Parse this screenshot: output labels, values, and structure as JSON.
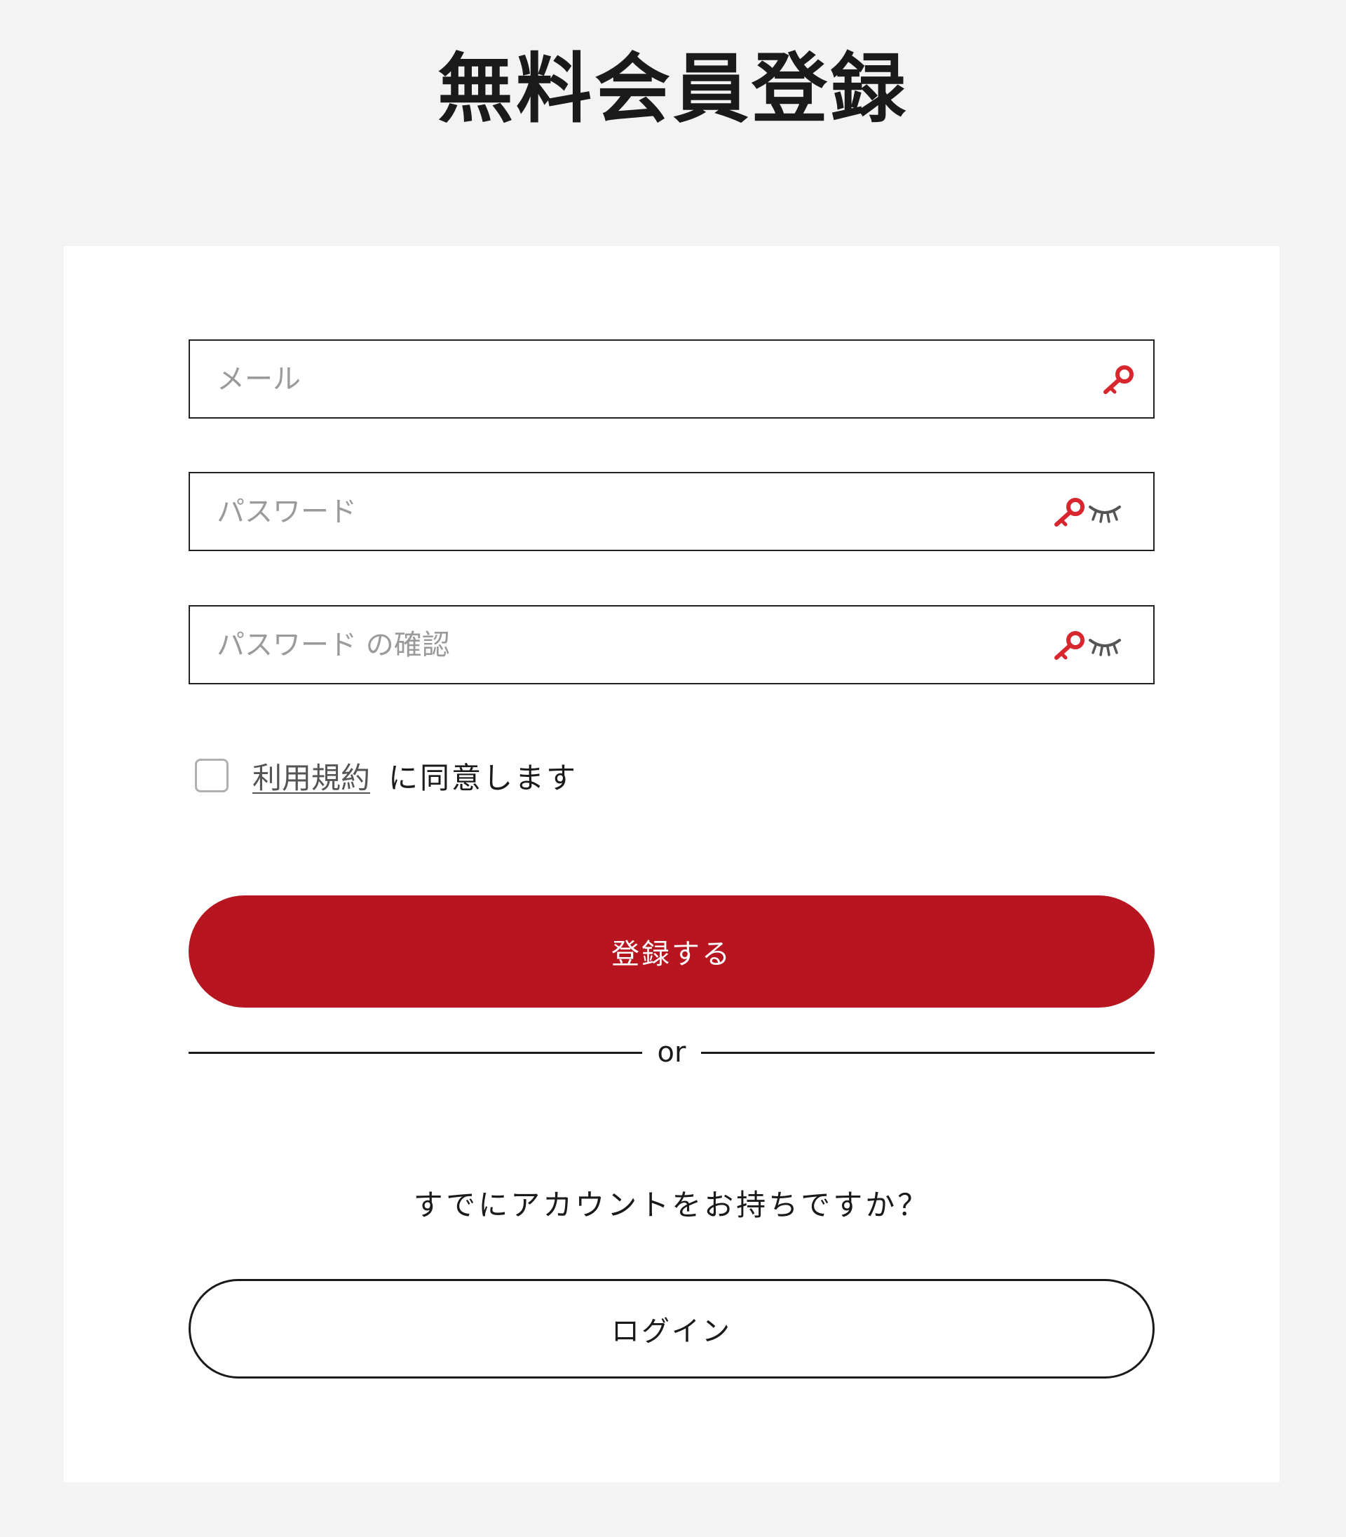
{
  "page": {
    "title": "無料会員登録"
  },
  "form": {
    "email_placeholder": "メール",
    "password_placeholder": "パスワード",
    "confirm_placeholder": "パスワード の確認",
    "terms_link": "利用規約",
    "terms_suffix": "に同意します",
    "terms_checked": false,
    "register_label": "登録する"
  },
  "divider": {
    "label": "or"
  },
  "login_section": {
    "prompt": "すでにアカウントをお持ちですか？",
    "login_label": "ログイン"
  },
  "colors": {
    "accent": "#b71520",
    "key_icon": "#d8262e",
    "eye_icon": "#555555",
    "background": "#f3f3f3",
    "card": "#ffffff"
  },
  "icons": {
    "autofill": "key-icon",
    "visibility": "eye-closed-icon"
  }
}
